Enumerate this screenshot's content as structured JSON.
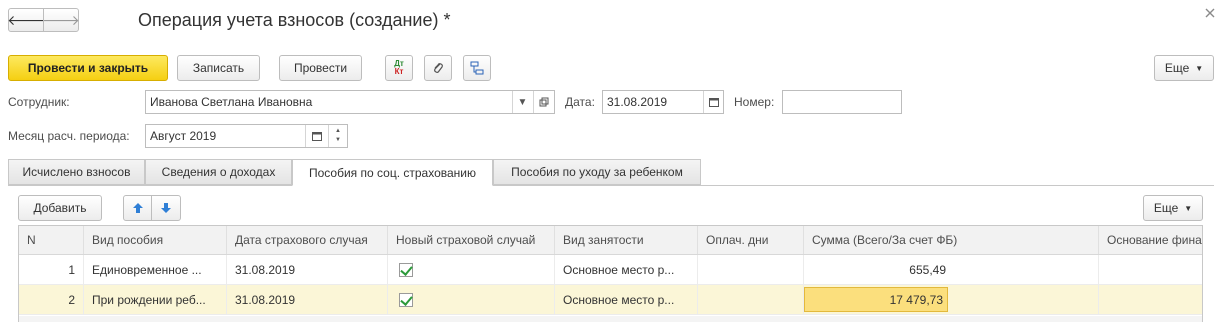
{
  "window": {
    "title": "Операция учета взносов (создание) *",
    "back_glyph": "🡐",
    "forward_glyph": "🡒"
  },
  "toolbar": {
    "post_and_close": "Провести и закрыть",
    "save": "Записать",
    "post": "Провести",
    "dt_kt_top": "Дт",
    "dt_kt_bottom": "Кт",
    "more": "Еще"
  },
  "form": {
    "employee_label": "Сотрудник:",
    "employee_value": "Иванова Светлана Ивановна",
    "date_label": "Дата:",
    "date_value": "31.08.2019",
    "number_label": "Номер:",
    "number_value": "",
    "period_label": "Месяц расч. периода:",
    "period_value": "Август 2019"
  },
  "tabs": [
    {
      "label": "Исчислено взносов"
    },
    {
      "label": "Сведения о доходах"
    },
    {
      "label": "Пособия по соц. страхованию"
    },
    {
      "label": "Пособия по уходу за ребенком"
    }
  ],
  "table_toolbar": {
    "add": "Добавить",
    "more": "Еще"
  },
  "table": {
    "columns": [
      "N",
      "Вид пособия",
      "Дата страхового случая",
      "Новый страховой случай",
      "Вид занятости",
      "Оплач. дни",
      "Сумма (Всего/За счет ФБ)",
      "Основание фина"
    ],
    "rows": [
      {
        "n": "1",
        "kind": "Единовременное ...",
        "date": "31.08.2019",
        "new_case": true,
        "employment": "Основное место р...",
        "days": "",
        "sum": "655,49",
        "basis": ""
      },
      {
        "n": "2",
        "kind": "При рождении реб...",
        "date": "31.08.2019",
        "new_case": true,
        "employment": "Основное место р...",
        "days": "",
        "sum": "17 479,73",
        "basis": ""
      }
    ]
  },
  "colors": {
    "primary_button": "#f5cf12",
    "selected_row": "#fbf6d7",
    "active_cell": "#fbdf7d"
  }
}
